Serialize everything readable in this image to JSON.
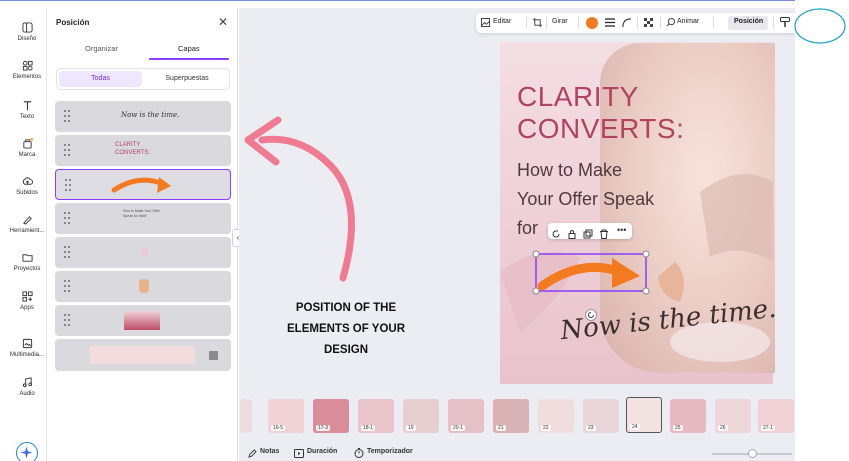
{
  "rail": {
    "items": [
      {
        "label": "Diseño",
        "icon": "layout-icon"
      },
      {
        "label": "Elementos",
        "icon": "elements-icon"
      },
      {
        "label": "Texto",
        "icon": "text-icon"
      },
      {
        "label": "Marca",
        "icon": "brand-icon"
      },
      {
        "label": "Subidos",
        "icon": "upload-icon"
      },
      {
        "label": "Herramient...",
        "icon": "draw-icon"
      },
      {
        "label": "Proyectos",
        "icon": "folder-icon"
      },
      {
        "label": "Apps",
        "icon": "apps-icon"
      },
      {
        "label": "Multimedia...",
        "icon": "media-icon"
      },
      {
        "label": "Audio",
        "icon": "audio-icon"
      }
    ]
  },
  "panel": {
    "title": "Posición",
    "tabs": [
      "Organizar",
      "Capas"
    ],
    "active_tab": "Capas",
    "filters": [
      "Todas",
      "Superpuestas"
    ],
    "active_filter": "Todas",
    "layers": [
      {
        "kind": "script",
        "preview": "Now is the time."
      },
      {
        "kind": "heading",
        "preview": "CLARITY CONVERTS:"
      },
      {
        "kind": "arrow",
        "selected": true
      },
      {
        "kind": "subtext",
        "preview": "How to Make Your Offer Speak for Itself"
      },
      {
        "kind": "faint"
      },
      {
        "kind": "hand"
      },
      {
        "kind": "photo"
      },
      {
        "kind": "background"
      }
    ]
  },
  "toolbar": {
    "edit": "Editar",
    "rotate": "Girar",
    "animate": "Animar",
    "position": "Posición",
    "accent_color": "#f47a20"
  },
  "canvas": {
    "heading_lines": [
      "CLARITY",
      "CONVERTS:"
    ],
    "sub_lines": [
      "How to Make",
      "Your Offer Speak",
      "for"
    ],
    "script": "Now is the time."
  },
  "thumbnails": [
    {
      "label": ""
    },
    {
      "label": "16-5"
    },
    {
      "label": "17-3"
    },
    {
      "label": "18-1"
    },
    {
      "label": "19"
    },
    {
      "label": "20-1"
    },
    {
      "label": "21"
    },
    {
      "label": "22"
    },
    {
      "label": "23"
    },
    {
      "label": "24"
    },
    {
      "label": "25"
    },
    {
      "label": "26"
    },
    {
      "label": "27-1"
    }
  ],
  "bottom": {
    "notes": "Notas",
    "duration": "Duración",
    "timer": "Temporizador"
  },
  "annotation": {
    "lines": [
      "POSITION OF THE",
      "ELEMENTS OF YOUR",
      "DESIGN"
    ]
  },
  "colors": {
    "accent": "#8b3dff",
    "heading_pink": "#b0435f",
    "arrow_pink": "#ef7a91",
    "arrow_orange": "#f47a20"
  }
}
